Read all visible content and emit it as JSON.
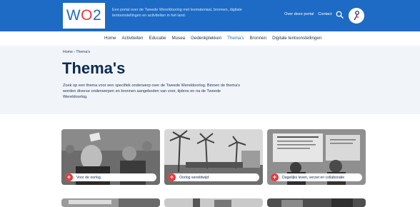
{
  "header": {
    "logo": {
      "prefix": "W",
      "o": "O",
      "suffix": "2"
    },
    "tagline": "Een portal over de Tweede Wereldoorlog met lesmateriaal, bronnen, digitale tentoonstellingen en activiteiten in het land.",
    "links": [
      "Over deze portal",
      "Contact"
    ]
  },
  "nav": {
    "items": [
      "Home",
      "Activiteiten",
      "Educatie",
      "Musea",
      "Gedenkplekken",
      "Thema's",
      "Bronnen",
      "Digitale tentoonstellingen"
    ],
    "active": "Thema's"
  },
  "breadcrumb": "Home › Thema's",
  "page": {
    "title": "Thema's",
    "intro": "Zoek op een thema voor een specifiek onderwerp over de Tweede Wereldoorlog. Binnen de thema's worden diverse onderwerpen en bronnen aangeboden van voor, tijdens en na de Tweede Wereldoorlog."
  },
  "cards": [
    {
      "label": "Voor de oorlog"
    },
    {
      "label": "Oorlog wereldwijd"
    },
    {
      "label": "Dagelijks leven, verzet en collaboratie"
    }
  ],
  "colors": {
    "brand": "#1d6bc4",
    "accent": "#e43b3b",
    "hero_bg": "#f1f5fa"
  }
}
